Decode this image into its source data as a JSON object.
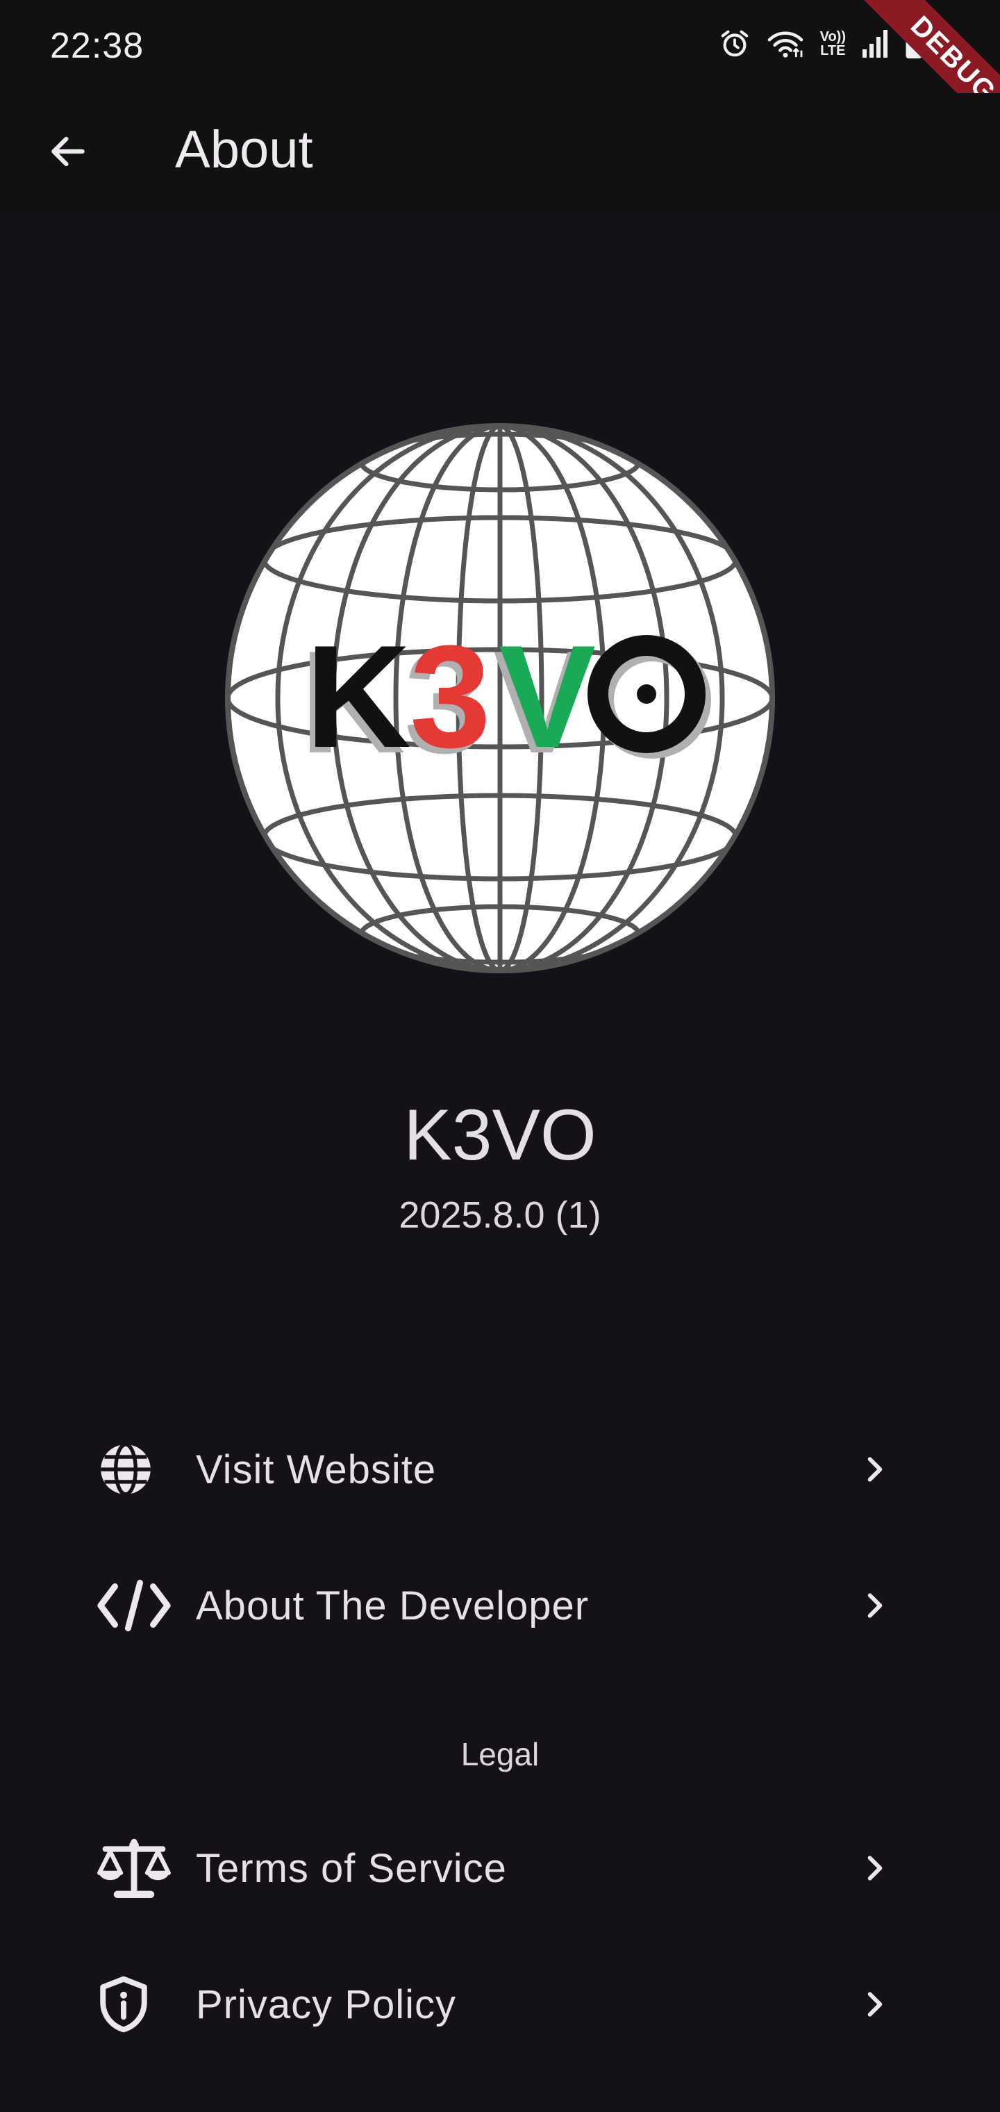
{
  "status_bar": {
    "time": "22:38",
    "icons": [
      "alarm-icon",
      "wifi-icon",
      "volte-icon",
      "signal-icon",
      "battery-icon"
    ],
    "volte_label_top": "Vo))",
    "volte_label_bottom": "LTE"
  },
  "debug_banner": {
    "label": "DEBUG"
  },
  "app_bar": {
    "title": "About",
    "back_icon": "arrow-back-icon"
  },
  "logo": {
    "wordmark_k": "K",
    "wordmark_3": "3",
    "wordmark_v": "V",
    "wordmark_o": "O",
    "colors": {
      "k": "#111111",
      "three": "#e53935",
      "v": "#1aaa55",
      "o": "#111111",
      "globe_lines": "#555555",
      "globe_fill": "#ffffff"
    }
  },
  "app_info": {
    "name": "K3VO",
    "version": "2025.8.0 (1)"
  },
  "links": [
    {
      "label": "Visit Website",
      "icon": "globe-icon"
    },
    {
      "label": "About The Developer",
      "icon": "code-icon"
    }
  ],
  "legal": {
    "title": "Legal",
    "items": [
      {
        "label": "Terms of Service",
        "icon": "scale-icon"
      },
      {
        "label": "Privacy Policy",
        "icon": "shield-icon"
      }
    ]
  },
  "theme": {
    "background": "#141118",
    "bar_background": "#111111",
    "text": "#e6e1e9"
  }
}
